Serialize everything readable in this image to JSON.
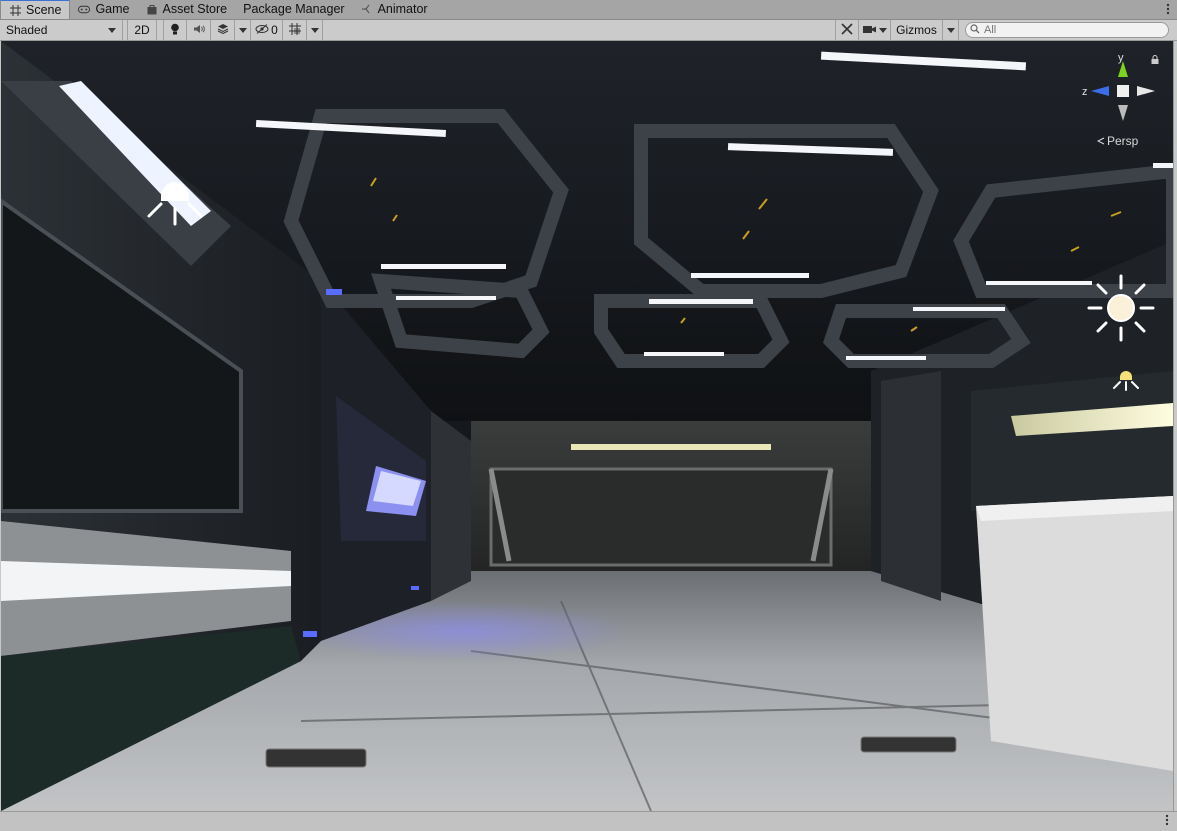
{
  "tabs": [
    {
      "label": "Scene",
      "icon": "grid-icon",
      "active": true
    },
    {
      "label": "Game",
      "icon": "gamepad-icon"
    },
    {
      "label": "Asset Store",
      "icon": "bag-icon"
    },
    {
      "label": "Package Manager",
      "icon": ""
    },
    {
      "label": "Animator",
      "icon": "animator-icon"
    }
  ],
  "toolbar": {
    "draw_mode": "Shaded",
    "mode_2d": "2D",
    "hidden_count": "0",
    "gizmos": "Gizmos",
    "search_placeholder": "All"
  },
  "viewport": {
    "projection_label": "Persp",
    "axis_y": "y",
    "axis_z": "z"
  },
  "colors": {
    "accent": "#3a72d8",
    "axis_x": "#ffffff",
    "axis_y": "#7ed321",
    "axis_z": "#3b6ee8"
  }
}
